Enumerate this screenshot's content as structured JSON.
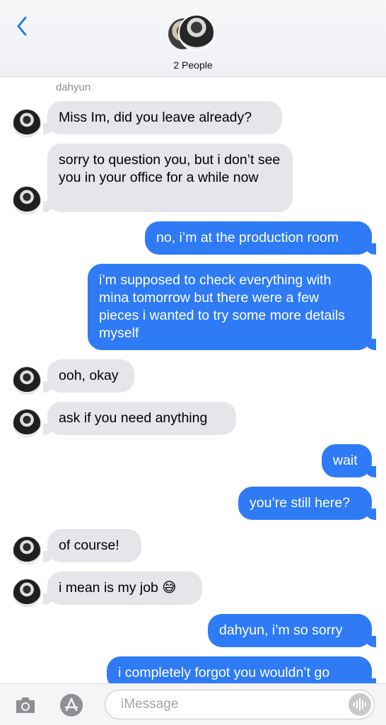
{
  "header": {
    "people_label": "2 People"
  },
  "thread": {
    "sender_name": "dahyun",
    "messages": [
      {
        "dir": "in",
        "text": "Miss Im, did you leave already?"
      },
      {
        "dir": "in",
        "text": "sorry to question you, but i don’t see you in your office for a while now"
      },
      {
        "dir": "out",
        "text": "no, i’m at the production room"
      },
      {
        "dir": "out",
        "text": "i’m supposed to check everything with mina tomorrow but there were a few pieces i wanted to try some more details myself"
      },
      {
        "dir": "in",
        "text": "ooh, okay"
      },
      {
        "dir": "in",
        "text": "ask if you need anything"
      },
      {
        "dir": "out",
        "text": "wait"
      },
      {
        "dir": "out",
        "text": "you’re still here?"
      },
      {
        "dir": "in",
        "text": "of course!"
      },
      {
        "dir": "in",
        "text": "i mean is my job 😅"
      },
      {
        "dir": "out",
        "text": "dahyun, i’m so sorry"
      },
      {
        "dir": "out",
        "text": "i completely forgot you wouldn’t go"
      }
    ]
  },
  "composer": {
    "placeholder": "iMessage"
  },
  "colors": {
    "accent": "#2f7bf6",
    "incoming_bubble": "#e5e5ea"
  }
}
